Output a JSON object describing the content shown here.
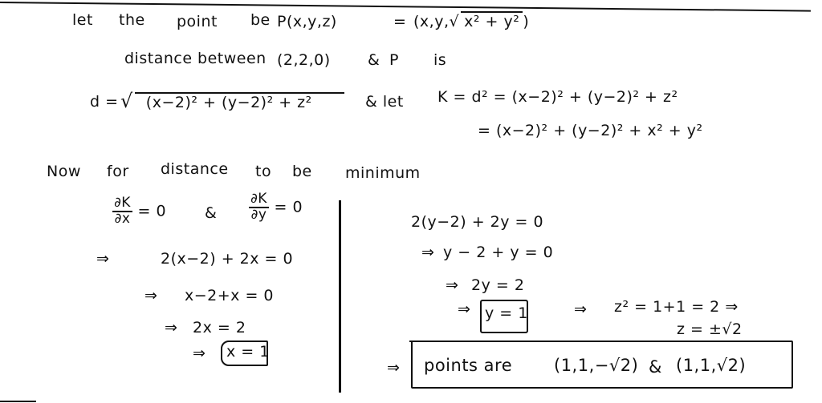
{
  "page": {
    "line1": {
      "w1": "let",
      "w2": "the",
      "w3": "point",
      "w4": "be",
      "point": "P(x,y,z)",
      "equals": "=",
      "tuple_start": "(x,y,",
      "radicand": "x² + y²",
      "tuple_end": ")"
    },
    "line2": {
      "text": "distance between",
      "point_a": "(2,2,0)",
      "and": "&",
      "p": "P",
      "is": "is"
    },
    "line3": {
      "lhs": "d =",
      "radicand": "(x−2)² + (y−2)² + z²",
      "and_let": "& let",
      "k_def": "K = d² = (x−2)² + (y−2)² + z²"
    },
    "line4": {
      "text": "= (x−2)² + (y−2)² + x² + y²"
    },
    "line5": {
      "w1": "Now",
      "w2": "for",
      "w3": "distance",
      "w4": "to",
      "w5": "be",
      "w6": "minimum"
    },
    "partials": {
      "dk": "∂K",
      "dx": "∂x",
      "eq0a": "= 0",
      "amp": "&",
      "dk2": "∂K",
      "dy": "∂y",
      "eq0b": "= 0"
    },
    "left_steps": [
      {
        "arrow": "⇒",
        "expr": "2(x−2) + 2x = 0"
      },
      {
        "arrow": "⇒",
        "expr": "x−2+x = 0"
      },
      {
        "arrow": "⇒",
        "expr": "2x = 2"
      },
      {
        "arrow": "⇒",
        "expr": "x = 1"
      }
    ],
    "right_steps": [
      {
        "arrow": "",
        "expr": "2(y−2) + 2y = 0"
      },
      {
        "arrow": "⇒",
        "expr": "y − 2 + y = 0"
      },
      {
        "arrow": "⇒",
        "expr": "2y = 2"
      },
      {
        "arrow": "⇒",
        "expr": "y = 1"
      }
    ],
    "z_step": {
      "arrow": "⇒",
      "expr": "z² = 1+1 = 2 ⇒",
      "result": "z = ±√2"
    },
    "conclusion": {
      "arrow": "⇒",
      "text": "points are",
      "p1": "(1,1,−√2)",
      "amp": "&",
      "p2": "(1,1,√2)"
    }
  }
}
